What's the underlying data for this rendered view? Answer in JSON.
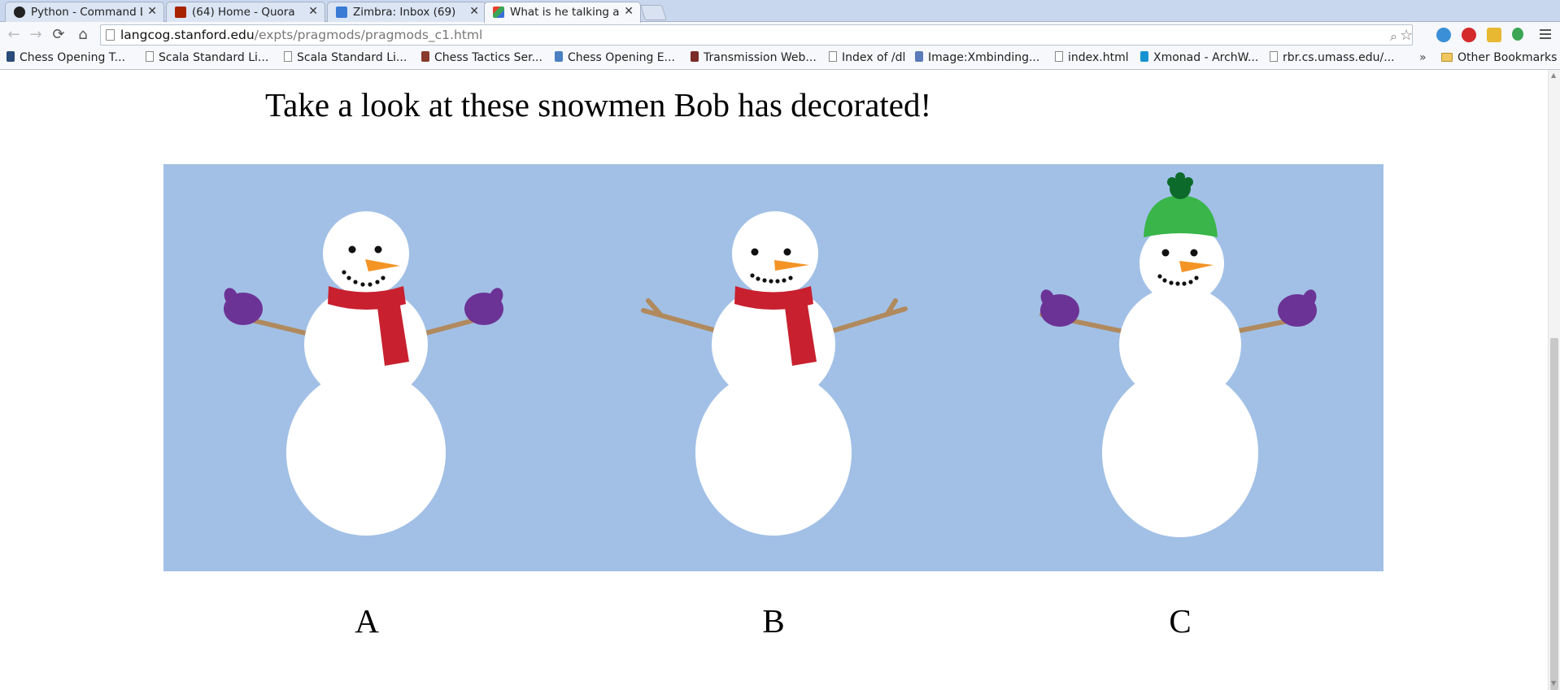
{
  "tabs": [
    {
      "title": "Python - Command Lin",
      "favicon": "python-favicon",
      "active": false
    },
    {
      "title": "(64) Home - Quora",
      "favicon": "quora-favicon",
      "active": false
    },
    {
      "title": "Zimbra: Inbox (69)",
      "favicon": "zimbra-favicon",
      "active": false
    },
    {
      "title": "What is he talking abo",
      "favicon": "cube-favicon",
      "active": true
    }
  ],
  "omnibox": {
    "host": "langcog.stanford.edu",
    "path": "/expts/pragmods/pragmods_c1.html"
  },
  "bookmarks": [
    "Chess Opening T...",
    "Scala Standard Li...",
    "Scala Standard Li...",
    "Chess Tactics Ser...",
    "Chess Opening E...",
    "Transmission Web...",
    "Index of /dl",
    "Image:Xmbinding...",
    "index.html",
    "Xmonad - ArchW...",
    "rbr.cs.umass.edu/..."
  ],
  "bookmarks_overflow": "»",
  "other_bookmarks": "Other Bookmarks",
  "page": {
    "heading": "Take a look at these snowmen Bob has decorated!",
    "choices": [
      "A",
      "B",
      "C"
    ],
    "snowmen": [
      {
        "label": "A",
        "scarf": true,
        "hat": false,
        "mittens": true
      },
      {
        "label": "B",
        "scarf": true,
        "hat": false,
        "mittens": false
      },
      {
        "label": "C",
        "scarf": false,
        "hat": true,
        "mittens": true
      }
    ]
  },
  "colors": {
    "sky": "#a2c0e6",
    "scarf": "#c8202f",
    "mitten": "#6c3396",
    "hat": "#39b54a",
    "pompom": "#0c6b2a",
    "carrot": "#f39425",
    "twig": "#b08a5e"
  }
}
